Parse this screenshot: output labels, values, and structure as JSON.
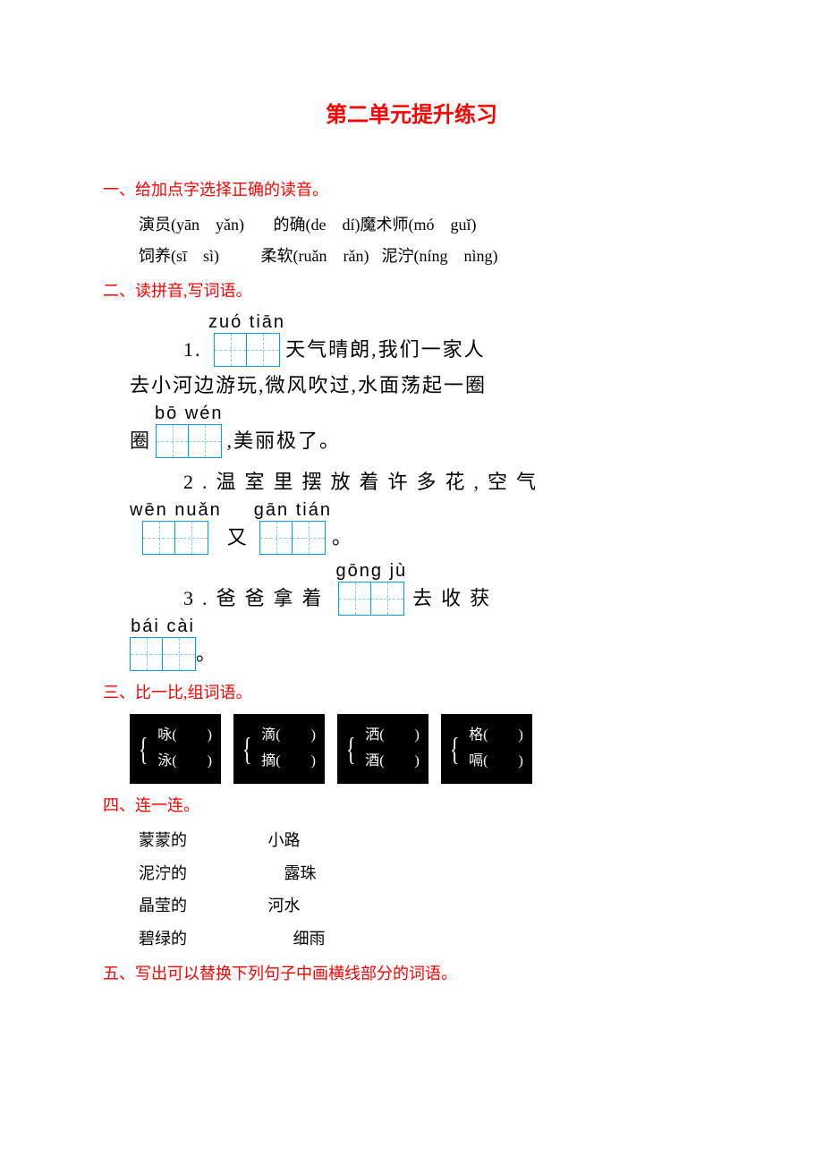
{
  "title": "第二单元提升练习",
  "sections": {
    "s1": {
      "header": "一、给加点字选择正确的读音。",
      "items": [
        {
          "word": "演员",
          "opts": "(yān　yǎn)"
        },
        {
          "word": "的确",
          "opts": "(de　dí)"
        },
        {
          "word": "魔术师",
          "opts": "(mó　guǐ)"
        },
        {
          "word": "饲养",
          "opts": "(sī　sì)"
        },
        {
          "word": "柔软",
          "opts": "(ruǎn　rǎn)"
        },
        {
          "word": "泥泞",
          "opts": "(níng　nìng)"
        }
      ]
    },
    "s2": {
      "header": "二、读拼音,写词语。",
      "q1": {
        "num": "1.",
        "pinyin1": "zuó tiān",
        "text1": "天气晴朗,我们一家人",
        "text2": "去小河边游玩,微风吹过,水面荡起一圈",
        "pinyin2": "bō wén",
        "text3": "圈",
        "text4": ",美丽极了。"
      },
      "q2": {
        "num": "2.",
        "text1": "温室里摆放着许多花,空气",
        "pinyin1": "wēn nuǎn",
        "pinyin2": "gān tián",
        "mid": "又",
        "end": "。"
      },
      "q3": {
        "num": "3.",
        "text1": "爸爸拿着",
        "pinyin1": "gōng jù",
        "text2": "去收获",
        "pinyin2": "bái cài",
        "end": "。"
      }
    },
    "s3": {
      "header": "三、比一比,组词语。",
      "groups": [
        {
          "a": "咏",
          "b": "泳"
        },
        {
          "a": "滴",
          "b": "摘"
        },
        {
          "a": "洒",
          "b": "酒"
        },
        {
          "a": "格",
          "b": "嗝"
        }
      ]
    },
    "s4": {
      "header": "四、连一连。",
      "pairs": [
        {
          "left": "蒙蒙的",
          "right": "小路"
        },
        {
          "left": "泥泞的",
          "right": "露珠"
        },
        {
          "left": "晶莹的",
          "right": "河水"
        },
        {
          "left": "碧绿的",
          "right": "细雨"
        }
      ]
    },
    "s5": {
      "header": "五、写出可以替换下列句子中画横线部分的词语。"
    }
  }
}
